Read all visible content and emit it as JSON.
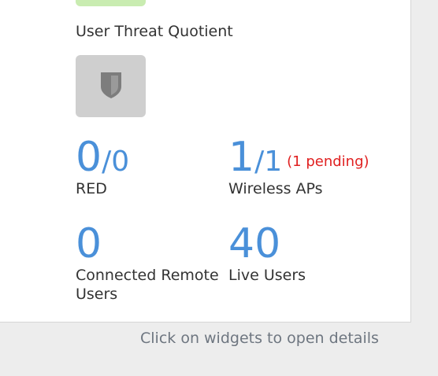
{
  "utq": {
    "label": "User Threat Quotient"
  },
  "shield_widget": {
    "icon": "shield-icon"
  },
  "red": {
    "value": "0",
    "total": "/0",
    "label": "RED"
  },
  "wireless": {
    "value": "1",
    "total": "/1",
    "pending": "(1 pending)",
    "label": "Wireless APs"
  },
  "remote": {
    "value": "0",
    "label": "Connected Remote Users"
  },
  "live": {
    "value": "40",
    "label": "Live Users"
  },
  "footer": {
    "hint": "Click on widgets to open details"
  },
  "colors": {
    "accent": "#4a90d9",
    "pending": "#e02020",
    "tile": "#cfcfcf",
    "utq_tile": "#c9ecb1"
  }
}
